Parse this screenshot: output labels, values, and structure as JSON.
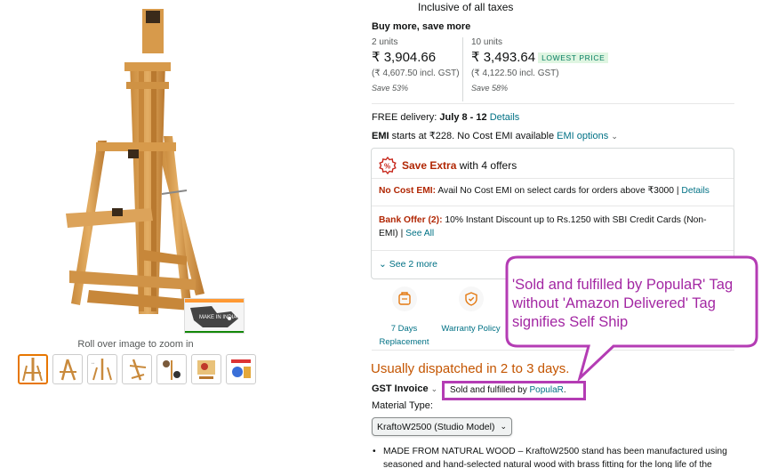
{
  "gallery": {
    "zoom_hint": "Roll over image to zoom in",
    "badge_text": "MAKE IN INDIA",
    "thumbnail_count": 7
  },
  "pricing": {
    "taxes_note": "Inclusive of all taxes",
    "bulk_title": "Buy more, save more",
    "tiers": [
      {
        "units": "2 units",
        "price": "₹ 3,904.66",
        "gst": "(₹ 4,607.50 incl. GST)",
        "save": "Save 53%"
      },
      {
        "units": "10 units",
        "price": "₹ 3,493.64",
        "gst": "(₹ 4,122.50 incl. GST)",
        "save": "Save 58%",
        "badge": "LOWEST PRICE"
      }
    ]
  },
  "delivery": {
    "prefix": "FREE delivery: ",
    "dates": "July 8 - 12",
    "details_link": "Details"
  },
  "emi": {
    "prefix": "EMI",
    "text": " starts at ₹228. No Cost EMI available ",
    "options_link": "EMI options"
  },
  "offers": {
    "title": "Save Extra",
    "subtitle": " with 4 offers",
    "items": [
      {
        "tag": "No Cost EMI:",
        "text": " Avail No Cost EMI on select cards for orders above ₹3000  | ",
        "link": "Details"
      },
      {
        "tag": "Bank Offer (2):",
        "text": " 10% Instant Discount up to Rs.1250 with SBI Credit Cards (Non-EMI)  | ",
        "link": "See All"
      }
    ],
    "see_more": "See 2 more"
  },
  "features": [
    {
      "label": "7 Days Replacement",
      "icon": "replacement-icon"
    },
    {
      "label": "Warranty Policy",
      "icon": "warranty-shield-icon"
    }
  ],
  "dispatch_text": "Usually dispatched in 2 to 3 days.",
  "gst_invoice": "GST Invoice",
  "seller": {
    "prefix": "Sold and fulfilled by ",
    "name": "PopulaR",
    "suffix": "."
  },
  "material": {
    "label": "Material Type:",
    "selected": "KraftoW2500 (Studio Model)"
  },
  "bullets": [
    "MADE FROM NATURAL WOOD – KraftoW2500 stand has been manufactured using seasoned and hand-selected natural wood with brass fitting for the long life of the"
  ],
  "annotation": {
    "text": "'Sold and fulfilled by PopulaR' Tag without 'Amazon Delivered' Tag signifies Self Ship",
    "color": "#b43cb4"
  }
}
